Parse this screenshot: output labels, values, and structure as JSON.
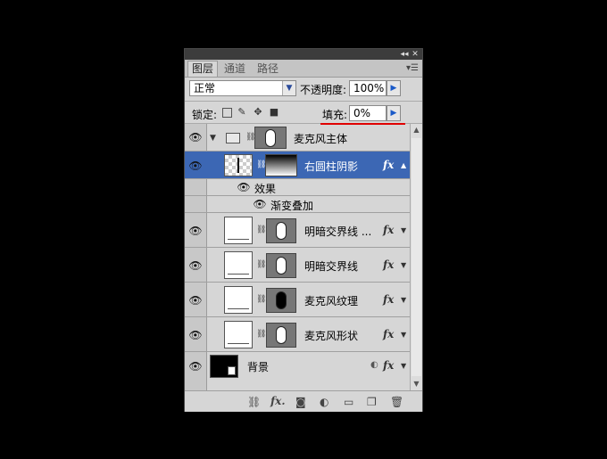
{
  "tabs": [
    "图层",
    "通道",
    "路径"
  ],
  "blend_mode": "正常",
  "opacity": {
    "label": "不透明度:",
    "value": "100%"
  },
  "lock": {
    "label": "锁定:"
  },
  "fill": {
    "label": "填充:",
    "value": "0%"
  },
  "layers": {
    "group": {
      "name": "麦克风主体"
    },
    "l1": {
      "name": "右圆柱阴影",
      "fx": "fx"
    },
    "effects": {
      "label": "效果"
    },
    "effect1": {
      "label": "渐变叠加"
    },
    "l2": {
      "name": "明暗交界线 ...",
      "fx": "fx"
    },
    "l3": {
      "name": "明暗交界线",
      "fx": "fx"
    },
    "l4": {
      "name": "麦克风纹理",
      "fx": "fx"
    },
    "l5": {
      "name": "麦克风形状",
      "fx": "fx"
    },
    "bg": {
      "name": "背景",
      "fx": "fx"
    }
  },
  "footer": {
    "fx": "fx."
  },
  "colors": {
    "selected": "#3c67b4",
    "highlight": "#e00000",
    "accent": "#1a5ac8"
  }
}
